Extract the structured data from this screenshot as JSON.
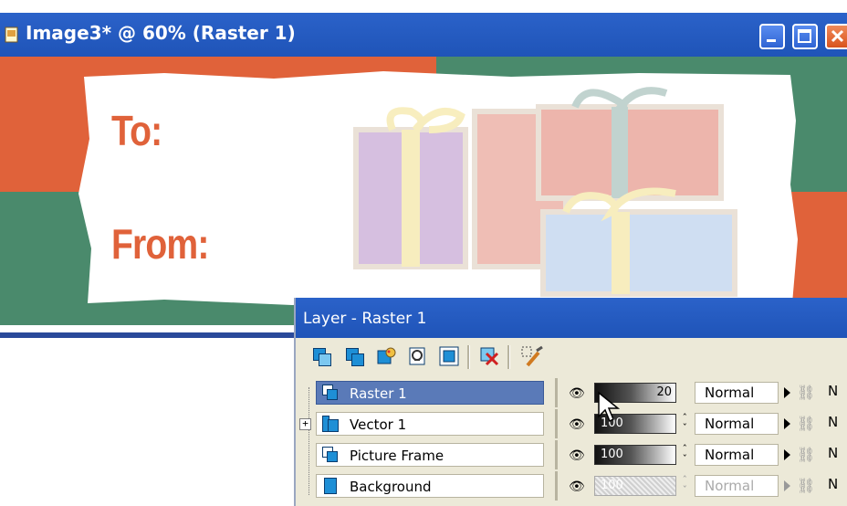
{
  "window": {
    "title": "Image3* @  60% (Raster 1)"
  },
  "canvas": {
    "to_label": "To:",
    "from_label": "From:",
    "colors": {
      "orange": "#e0623a",
      "green": "#4a8a6c",
      "white": "#ffffff"
    }
  },
  "layer_palette": {
    "title": "Layer - Raster 1",
    "toolbar_icons": [
      "new-raster-layer-icon",
      "new-vector-layer-icon",
      "new-art-media-layer-icon",
      "new-mask-layer-icon",
      "new-adjustment-layer-icon",
      "delete-layer-icon",
      "edit-selection-icon"
    ],
    "layers": [
      {
        "name": "Raster 1",
        "opacity": "20",
        "blend": "Normal",
        "selected": true,
        "trailing": "N"
      },
      {
        "name": "Vector 1",
        "opacity": "100",
        "blend": "Normal",
        "selected": false,
        "expandable": true,
        "trailing": "N"
      },
      {
        "name": "Picture Frame",
        "opacity": "100",
        "blend": "Normal",
        "selected": false,
        "trailing": "N"
      },
      {
        "name": "Background",
        "opacity": "100",
        "blend": "Normal",
        "selected": false,
        "disabled": true,
        "trailing": "N"
      }
    ],
    "expander_glyph": "+"
  }
}
